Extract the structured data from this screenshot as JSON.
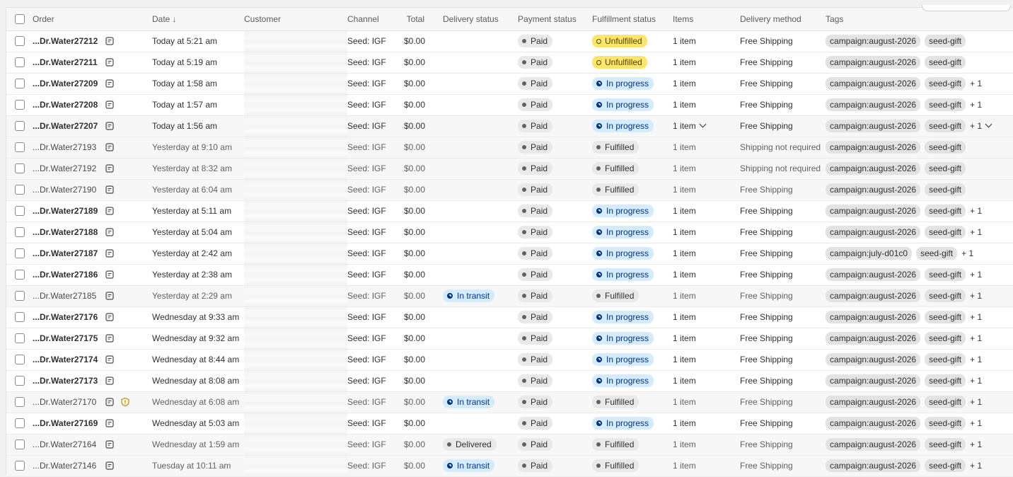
{
  "columns": {
    "order": "Order",
    "date": "Date",
    "date_sort": "↓",
    "customer": "Customer",
    "channel": "Channel",
    "total": "Total",
    "delivery_status": "Delivery status",
    "payment_status": "Payment status",
    "fulfillment_status": "Fulfillment status",
    "items": "Items",
    "delivery_method": "Delivery method",
    "tags": "Tags"
  },
  "colors": {
    "unfulfilled": "#ffe56b",
    "in_progress": "#d5ebff",
    "neutral_badge": "#e9e9e9",
    "tag": "#e3e3e3"
  },
  "rows": [
    {
      "order": "...Dr.Water27212",
      "date": "Today at 5:21 am",
      "channel": "Seed: IGF",
      "total": "$0.00",
      "delivery": "",
      "payment": "Paid",
      "fulfillment": "Unfulfilled",
      "items": "1 item",
      "method": "Free Shipping",
      "tags": [
        "campaign:august-2026",
        "seed-gift"
      ],
      "more": ""
    },
    {
      "order": "...Dr.Water27211",
      "date": "Today at 5:19 am",
      "channel": "Seed: IGF",
      "total": "$0.00",
      "delivery": "",
      "payment": "Paid",
      "fulfillment": "Unfulfilled",
      "items": "1 item",
      "method": "Free Shipping",
      "tags": [
        "campaign:august-2026",
        "seed-gift"
      ],
      "more": ""
    },
    {
      "order": "...Dr.Water27209",
      "date": "Today at 1:58 am",
      "channel": "Seed: IGF",
      "total": "$0.00",
      "delivery": "",
      "payment": "Paid",
      "fulfillment": "In progress",
      "items": "1 item",
      "method": "Free Shipping",
      "tags": [
        "campaign:august-2026",
        "seed-gift"
      ],
      "more": "+ 1"
    },
    {
      "order": "...Dr.Water27208",
      "date": "Today at 1:57 am",
      "channel": "Seed: IGF",
      "total": "$0.00",
      "delivery": "",
      "payment": "Paid",
      "fulfillment": "In progress",
      "items": "1 item",
      "method": "Free Shipping",
      "tags": [
        "campaign:august-2026",
        "seed-gift"
      ],
      "more": "+ 1"
    },
    {
      "order": "...Dr.Water27207",
      "date": "Today at 1:56 am",
      "channel": "Seed: IGF",
      "total": "$0.00",
      "delivery": "",
      "payment": "Paid",
      "fulfillment": "In progress",
      "items": "1 item",
      "method": "Free Shipping",
      "tags": [
        "campaign:august-2026",
        "seed-gift"
      ],
      "more": "+ 1",
      "hover": true
    },
    {
      "order": "...Dr.Water27193",
      "date": "Yesterday at 9:10 am",
      "channel": "Seed: IGF",
      "total": "$0.00",
      "delivery": "",
      "payment": "Paid",
      "fulfillment": "Fulfilled",
      "items": "1 item",
      "method": "Shipping not required",
      "tags": [
        "campaign:august-2026",
        "seed-gift"
      ],
      "more": "",
      "archived": true
    },
    {
      "order": "...Dr.Water27192",
      "date": "Yesterday at 8:32 am",
      "channel": "Seed: IGF",
      "total": "$0.00",
      "delivery": "",
      "payment": "Paid",
      "fulfillment": "Fulfilled",
      "items": "1 item",
      "method": "Shipping not required",
      "tags": [
        "campaign:august-2026",
        "seed-gift"
      ],
      "more": "",
      "archived": true
    },
    {
      "order": "...Dr.Water27190",
      "date": "Yesterday at 6:04 am",
      "channel": "Seed: IGF",
      "total": "$0.00",
      "delivery": "",
      "payment": "Paid",
      "fulfillment": "Fulfilled",
      "items": "1 item",
      "method": "Free Shipping",
      "tags": [
        "campaign:august-2026",
        "seed-gift"
      ],
      "more": "",
      "archived": true
    },
    {
      "order": "...Dr.Water27189",
      "date": "Yesterday at 5:11 am",
      "channel": "Seed: IGF",
      "total": "$0.00",
      "delivery": "",
      "payment": "Paid",
      "fulfillment": "In progress",
      "items": "1 item",
      "method": "Free Shipping",
      "tags": [
        "campaign:august-2026",
        "seed-gift"
      ],
      "more": "+ 1"
    },
    {
      "order": "...Dr.Water27188",
      "date": "Yesterday at 5:04 am",
      "channel": "Seed: IGF",
      "total": "$0.00",
      "delivery": "",
      "payment": "Paid",
      "fulfillment": "In progress",
      "items": "1 item",
      "method": "Free Shipping",
      "tags": [
        "campaign:august-2026",
        "seed-gift"
      ],
      "more": "+ 1"
    },
    {
      "order": "...Dr.Water27187",
      "date": "Yesterday at 2:42 am",
      "channel": "Seed: IGF",
      "total": "$0.00",
      "delivery": "",
      "payment": "Paid",
      "fulfillment": "In progress",
      "items": "1 item",
      "method": "Free Shipping",
      "tags": [
        "campaign:july-d01c0",
        "seed-gift"
      ],
      "more": "+ 1"
    },
    {
      "order": "...Dr.Water27186",
      "date": "Yesterday at 2:38 am",
      "channel": "Seed: IGF",
      "total": "$0.00",
      "delivery": "",
      "payment": "Paid",
      "fulfillment": "In progress",
      "items": "1 item",
      "method": "Free Shipping",
      "tags": [
        "campaign:august-2026",
        "seed-gift"
      ],
      "more": "+ 1"
    },
    {
      "order": "...Dr.Water27185",
      "date": "Yesterday at 2:29 am",
      "channel": "Seed: IGF",
      "total": "$0.00",
      "delivery": "In transit",
      "payment": "Paid",
      "fulfillment": "Fulfilled",
      "items": "1 item",
      "method": "Free Shipping",
      "tags": [
        "campaign:august-2026",
        "seed-gift"
      ],
      "more": "+ 1",
      "archived": true
    },
    {
      "order": "...Dr.Water27176",
      "date": "Wednesday at 9:33 am",
      "channel": "Seed: IGF",
      "total": "$0.00",
      "delivery": "",
      "payment": "Paid",
      "fulfillment": "In progress",
      "items": "1 item",
      "method": "Free Shipping",
      "tags": [
        "campaign:august-2026",
        "seed-gift"
      ],
      "more": "+ 1"
    },
    {
      "order": "...Dr.Water27175",
      "date": "Wednesday at 9:32 am",
      "channel": "Seed: IGF",
      "total": "$0.00",
      "delivery": "",
      "payment": "Paid",
      "fulfillment": "In progress",
      "items": "1 item",
      "method": "Free Shipping",
      "tags": [
        "campaign:august-2026",
        "seed-gift"
      ],
      "more": "+ 1"
    },
    {
      "order": "...Dr.Water27174",
      "date": "Wednesday at 8:44 am",
      "channel": "Seed: IGF",
      "total": "$0.00",
      "delivery": "",
      "payment": "Paid",
      "fulfillment": "In progress",
      "items": "1 item",
      "method": "Free Shipping",
      "tags": [
        "campaign:august-2026",
        "seed-gift"
      ],
      "more": "+ 1"
    },
    {
      "order": "...Dr.Water27173",
      "date": "Wednesday at 8:08 am",
      "channel": "Seed: IGF",
      "total": "$0.00",
      "delivery": "",
      "payment": "Paid",
      "fulfillment": "In progress",
      "items": "1 item",
      "method": "Free Shipping",
      "tags": [
        "campaign:august-2026",
        "seed-gift"
      ],
      "more": "+ 1"
    },
    {
      "order": "...Dr.Water27170",
      "date": "Wednesday at 6:08 am",
      "channel": "Seed: IGF",
      "total": "$0.00",
      "delivery": "In transit",
      "payment": "Paid",
      "fulfillment": "Fulfilled",
      "items": "1 item",
      "method": "Free Shipping",
      "tags": [
        "campaign:august-2026",
        "seed-gift"
      ],
      "more": "+ 1",
      "archived": true,
      "risk": true
    },
    {
      "order": "...Dr.Water27169",
      "date": "Wednesday at 5:03 am",
      "channel": "Seed: IGF",
      "total": "$0.00",
      "delivery": "",
      "payment": "Paid",
      "fulfillment": "In progress",
      "items": "1 item",
      "method": "Free Shipping",
      "tags": [
        "campaign:august-2026",
        "seed-gift"
      ],
      "more": "+ 1"
    },
    {
      "order": "...Dr.Water27164",
      "date": "Wednesday at 1:59 am",
      "channel": "Seed: IGF",
      "total": "$0.00",
      "delivery": "Delivered",
      "payment": "Paid",
      "fulfillment": "Fulfilled",
      "items": "1 item",
      "method": "Free Shipping",
      "tags": [
        "campaign:august-2026",
        "seed-gift"
      ],
      "more": "+ 1",
      "archived": true
    },
    {
      "order": "...Dr.Water27146",
      "date": "Tuesday at 10:11 am",
      "channel": "Seed: IGF",
      "total": "$0.00",
      "delivery": "In transit",
      "payment": "Paid",
      "fulfillment": "Fulfilled",
      "items": "1 item",
      "method": "Free Shipping",
      "tags": [
        "campaign:august-2026",
        "seed-gift"
      ],
      "more": "+ 1",
      "archived": true
    }
  ]
}
